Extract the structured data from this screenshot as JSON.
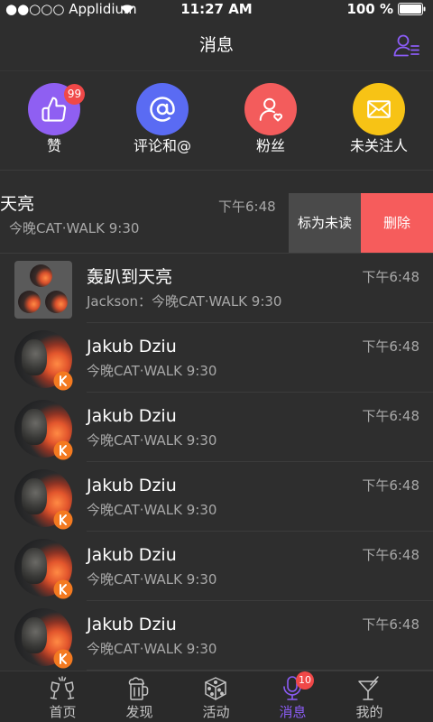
{
  "status_bar": {
    "carrier": "●●○○○ Applidium",
    "time": "11:27 AM",
    "battery": "100 %",
    "wifi_icon": "wifi-icon",
    "battery_icon": "battery-icon"
  },
  "header": {
    "title": "消息",
    "right_icon": "contacts-list-icon"
  },
  "categories": [
    {
      "label": "赞",
      "icon": "thumbs-up-icon",
      "color": "#8f5ff2",
      "badge": "99"
    },
    {
      "label": "评论和@",
      "icon": "at-sign-icon",
      "color": "#5a6bf3"
    },
    {
      "label": "粉丝",
      "icon": "person-heart-icon",
      "color": "#f35c5c"
    },
    {
      "label": "未关注人",
      "icon": "envelope-icon",
      "color": "#f7c315"
    }
  ],
  "swiped_conversation": {
    "title": "天亮",
    "preview": "今晚CAT·WALK 9:30",
    "time": "下午6:48",
    "actions": [
      {
        "label": "标为未读",
        "color": "#4a4a4a"
      },
      {
        "label": "删除",
        "color": "#f65c5c"
      }
    ]
  },
  "conversations": [
    {
      "title": "轰趴到天亮",
      "preview": "Jackson：今晚CAT·WALK 9:30",
      "time": "下午6:48",
      "avatar": "group-avatar"
    },
    {
      "title": "Jakub Dziu",
      "preview": "今晚CAT·WALK 9:30",
      "time": "下午6:48",
      "avatar": "user-avatar",
      "avatar_badge": "k-logo-icon"
    },
    {
      "title": "Jakub Dziu",
      "preview": "今晚CAT·WALK 9:30",
      "time": "下午6:48",
      "avatar": "user-avatar",
      "avatar_badge": "k-logo-icon"
    },
    {
      "title": "Jakub Dziu",
      "preview": "今晚CAT·WALK 9:30",
      "time": "下午6:48",
      "avatar": "user-avatar",
      "avatar_badge": "k-logo-icon"
    },
    {
      "title": "Jakub Dziu",
      "preview": "今晚CAT·WALK 9:30",
      "time": "下午6:48",
      "avatar": "user-avatar",
      "avatar_badge": "k-logo-icon"
    },
    {
      "title": "Jakub Dziu",
      "preview": "今晚CAT·WALK 9:30",
      "time": "下午6:48",
      "avatar": "user-avatar",
      "avatar_badge": "k-logo-icon"
    }
  ],
  "tab_bar": {
    "tabs": [
      {
        "label": "首页",
        "icon": "cheers-glasses-icon"
      },
      {
        "label": "发现",
        "icon": "beer-mug-icon"
      },
      {
        "label": "活动",
        "icon": "dice-icon"
      },
      {
        "label": "消息",
        "icon": "microphone-icon",
        "active": true,
        "badge": "10"
      },
      {
        "label": "我的",
        "icon": "cocktail-icon"
      }
    ]
  },
  "colors": {
    "background": "#2e2e2e",
    "accent": "#8b5cf6",
    "badge": "#f04848",
    "secondary_text": "#a8a8a8",
    "avatar_badge": "#f47a20"
  }
}
